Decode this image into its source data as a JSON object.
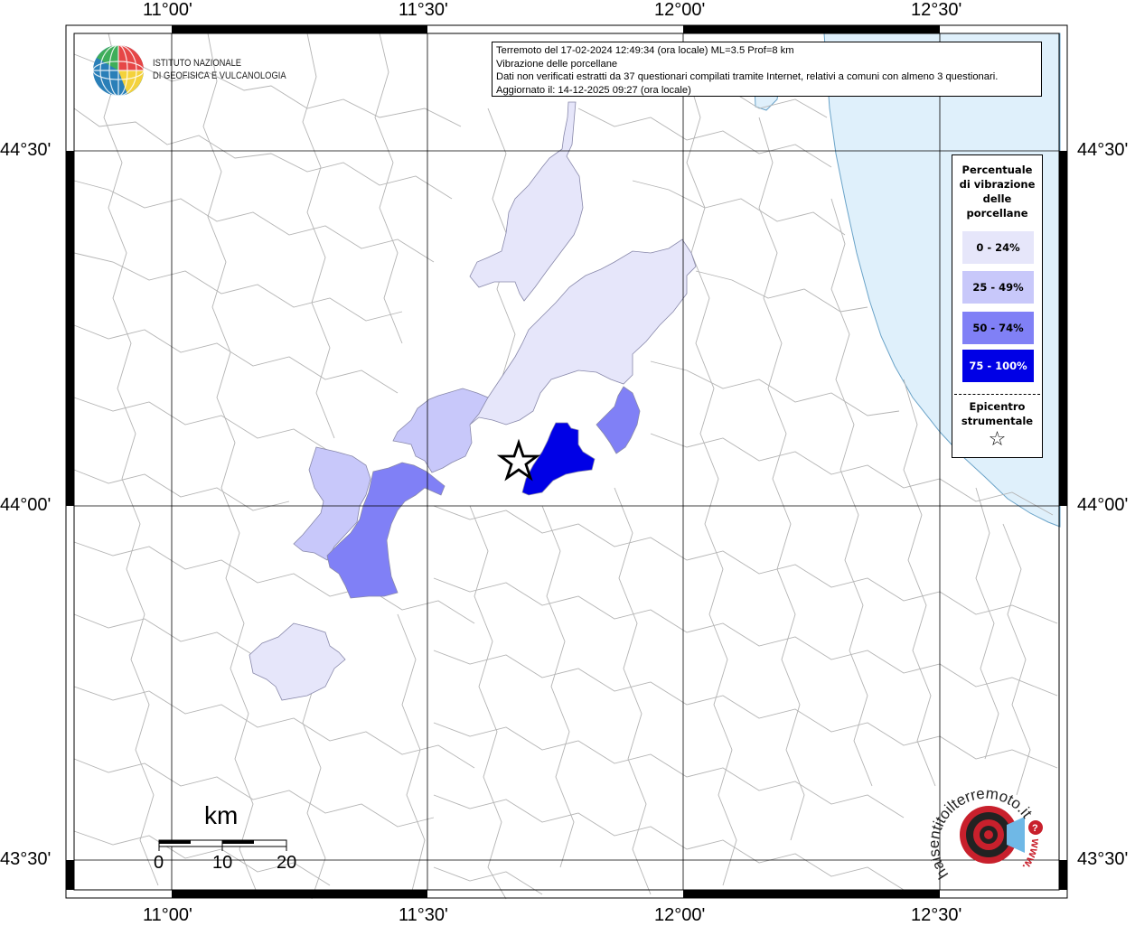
{
  "info_box": {
    "line1": "Terremoto del 17-02-2024 12:49:34 (ora locale) ML=3.5 Prof=8 km",
    "line2": "Vibrazione delle porcellane",
    "line3": "Dati non verificati estratti da 37 questionari compilati tramite Internet, relativi a comuni con almeno 3 questionari.",
    "line4": "Aggiornato il: 14-12-2025 09:27 (ora locale)"
  },
  "institute": {
    "line1": "ISTITUTO NAZIONALE",
    "line2": "DI GEOFISICA E VULCANOLOGIA"
  },
  "longitudes": [
    "11°00'",
    "11°30'",
    "12°00'",
    "12°30'"
  ],
  "latitudes": [
    "44°30'",
    "44°00'",
    "43°30'"
  ],
  "legend": {
    "title": "Percentuale di vibrazione delle porcellane",
    "classes": [
      {
        "label": "0 - 24%",
        "color": "#e6e6fa"
      },
      {
        "label": "25 - 49%",
        "color": "#c8c8fa"
      },
      {
        "label": "50 - 74%",
        "color": "#8080f6"
      },
      {
        "label": "75 - 100%",
        "color": "#0000e6"
      }
    ],
    "epicenter_label": "Epicentro strumentale",
    "epicenter_symbol": "☆"
  },
  "scale_bar": {
    "unit": "km",
    "ticks": [
      "0",
      "10",
      "20"
    ]
  },
  "logo_hst": {
    "text_main": "haisentitoilterremoto.it",
    "text_www": "www."
  },
  "colors": {
    "sea": "#dff0fb",
    "border": "#aaaaaa",
    "grid": "#000000"
  }
}
